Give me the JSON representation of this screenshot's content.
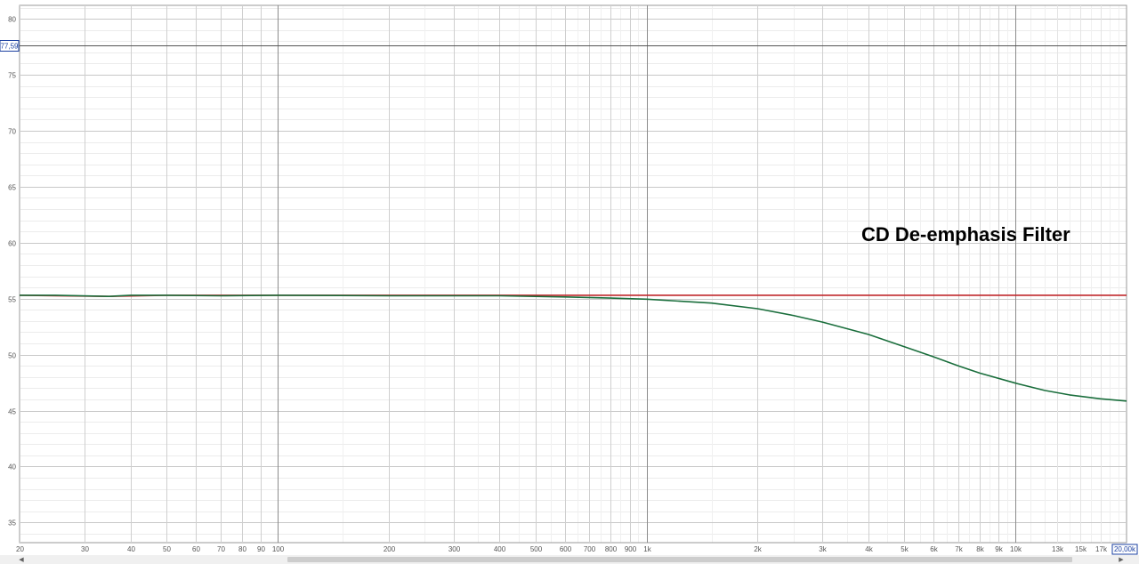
{
  "chart_data": {
    "type": "line",
    "title": "CD De-emphasis Filter",
    "xlabel": "",
    "ylabel": "",
    "x_scale": "log",
    "xlim": [
      20,
      20000
    ],
    "ylim": [
      33.2,
      81.2
    ],
    "grid": true,
    "x_tick_values": [
      20,
      30,
      40,
      50,
      60,
      70,
      80,
      90,
      100,
      200,
      300,
      400,
      500,
      600,
      700,
      800,
      900,
      1000,
      2000,
      3000,
      4000,
      5000,
      6000,
      7000,
      8000,
      9000,
      10000,
      13000,
      15000,
      17000
    ],
    "x_tick_labels": [
      "20",
      "30",
      "40",
      "50",
      "60",
      "70",
      "80",
      "90",
      "100",
      "200",
      "300",
      "400",
      "500",
      "600",
      "700",
      "800",
      "900",
      "1k",
      "2k",
      "3k",
      "4k",
      "5k",
      "6k",
      "7k",
      "8k",
      "9k",
      "10k",
      "13k",
      "15k",
      "17k"
    ],
    "x_tick_faint": [
      false,
      false,
      false,
      false,
      false,
      false,
      false,
      false,
      false,
      false,
      false,
      false,
      false,
      false,
      false,
      false,
      false,
      false,
      false,
      false,
      false,
      false,
      false,
      false,
      false,
      false,
      false,
      true,
      true,
      true
    ],
    "x_end_label": "20,00k",
    "y_tick_values": [
      35,
      40,
      45,
      50,
      55,
      60,
      65,
      70,
      75,
      80
    ],
    "y_tick_labels": [
      "35",
      "40",
      "45",
      "50",
      "55",
      "60",
      "65",
      "70",
      "75",
      "80"
    ],
    "cursor": {
      "y": 77.59,
      "label": "77,59"
    },
    "series": [
      {
        "color": "#c0282d",
        "x": [
          20,
          35,
          50,
          100,
          200,
          500,
          1000,
          2000,
          5000,
          10000,
          20000
        ],
        "y": [
          55.3,
          55.2,
          55.3,
          55.3,
          55.3,
          55.3,
          55.3,
          55.3,
          55.3,
          55.3,
          55.3
        ]
      },
      {
        "color": "#1a6e3c",
        "x": [
          20,
          25,
          35,
          40,
          50,
          70,
          100,
          200,
          400,
          600,
          800,
          1000,
          1500,
          2000,
          2500,
          3000,
          4000,
          5000,
          6000,
          7000,
          8000,
          10000,
          12000,
          14000,
          17000,
          20000
        ],
        "y": [
          55.3,
          55.3,
          55.2,
          55.3,
          55.3,
          55.25,
          55.3,
          55.25,
          55.25,
          55.15,
          55.05,
          54.95,
          54.6,
          54.1,
          53.5,
          52.9,
          51.8,
          50.7,
          49.8,
          49.0,
          48.35,
          47.45,
          46.8,
          46.4,
          46.05,
          45.85
        ]
      }
    ]
  }
}
